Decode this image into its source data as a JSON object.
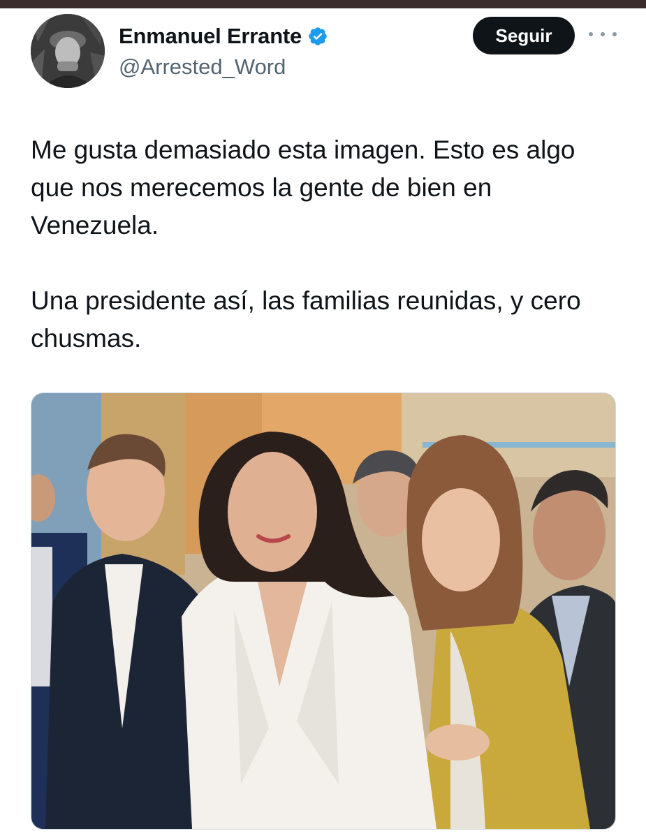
{
  "tweet": {
    "author": {
      "display_name": "Enmanuel Errante",
      "handle": "@Arrested_Word",
      "verified": true,
      "avatar_icon": "user-avatar-photo"
    },
    "follow_label": "Seguir",
    "more_icon": "more-options-icon",
    "text": {
      "paragraph1": "Me gusta demasiado esta imagen. Esto es algo que nos merecemos la gente de bien en Venezuela.",
      "paragraph2": "Una presidente así, las familias reunidas, y cero chusmas."
    },
    "media": {
      "type": "photo"
    }
  },
  "colors": {
    "follow_button_bg": "#0f1419",
    "verified_badge": "#1d9bf0",
    "handle_text": "#536471",
    "top_bar": "#3a2b2c"
  }
}
